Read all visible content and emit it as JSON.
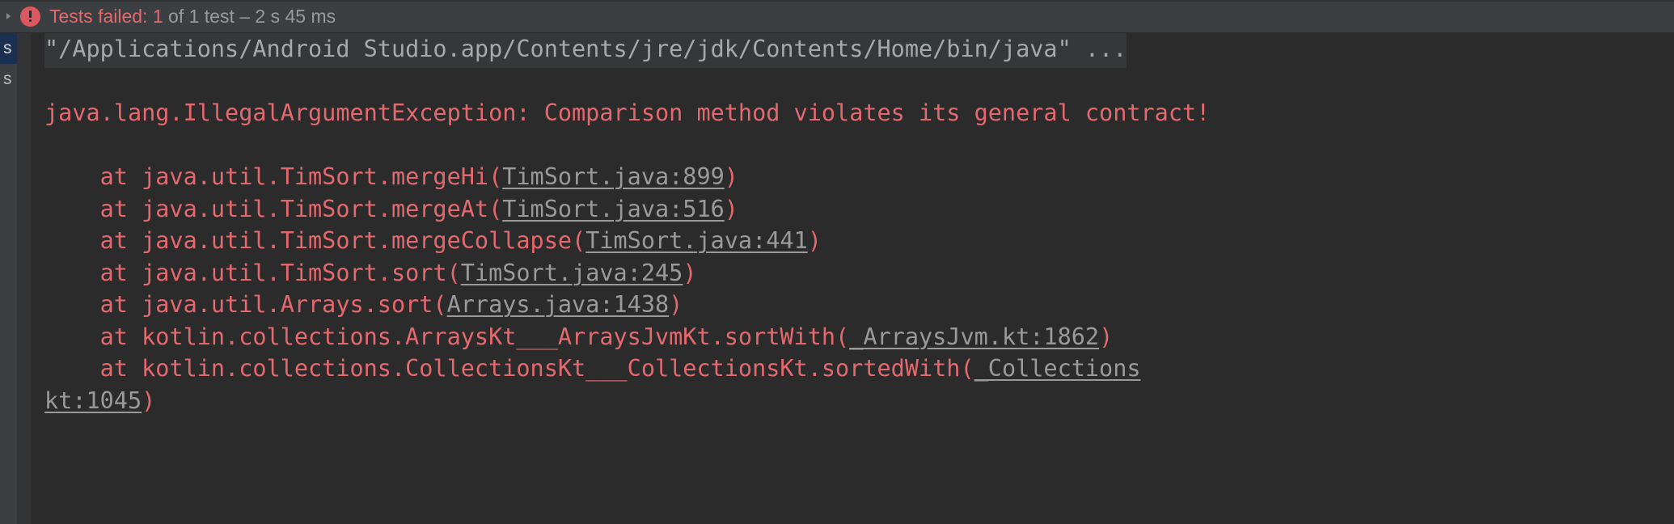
{
  "topbar": {
    "twisty_icon": "collapse-triangle-icon",
    "status_icon": "error-circle-icon",
    "status_failed_label": "Tests failed: ",
    "status_failed_count": "1",
    "status_of_total": " of 1 test ",
    "status_duration": "– 2 s 45 ms"
  },
  "tree": {
    "rows": [
      {
        "label": "s",
        "selected": true
      },
      {
        "label": "s",
        "selected": false
      }
    ]
  },
  "console": {
    "lines": [
      {
        "kind": "cmd",
        "segments": [
          {
            "type": "highlight",
            "text": "\"/Applications/Android Studio.app/Contents/jre/jdk/Contents/Home/bin/java\" ..."
          }
        ]
      },
      {
        "kind": "blank",
        "segments": [
          {
            "type": "plain",
            "text": " "
          }
        ]
      },
      {
        "kind": "error",
        "segments": [
          {
            "type": "plain",
            "text": "java.lang.IllegalArgumentException: Comparison method violates its general contract!"
          }
        ]
      },
      {
        "kind": "blank",
        "segments": [
          {
            "type": "plain",
            "text": " "
          }
        ]
      },
      {
        "kind": "trace",
        "segments": [
          {
            "type": "plain",
            "text": "    at java.util.TimSort.mergeHi("
          },
          {
            "type": "link",
            "text": "TimSort.java:899"
          },
          {
            "type": "plain",
            "text": ")"
          }
        ]
      },
      {
        "kind": "trace",
        "segments": [
          {
            "type": "plain",
            "text": "    at java.util.TimSort.mergeAt("
          },
          {
            "type": "link",
            "text": "TimSort.java:516"
          },
          {
            "type": "plain",
            "text": ")"
          }
        ]
      },
      {
        "kind": "trace",
        "segments": [
          {
            "type": "plain",
            "text": "    at java.util.TimSort.mergeCollapse("
          },
          {
            "type": "link",
            "text": "TimSort.java:441"
          },
          {
            "type": "plain",
            "text": ")"
          }
        ]
      },
      {
        "kind": "trace",
        "segments": [
          {
            "type": "plain",
            "text": "    at java.util.TimSort.sort("
          },
          {
            "type": "link",
            "text": "TimSort.java:245"
          },
          {
            "type": "plain",
            "text": ")"
          }
        ]
      },
      {
        "kind": "trace",
        "segments": [
          {
            "type": "plain",
            "text": "    at java.util.Arrays.sort("
          },
          {
            "type": "link",
            "text": "Arrays.java:1438"
          },
          {
            "type": "plain",
            "text": ")"
          }
        ]
      },
      {
        "kind": "trace",
        "segments": [
          {
            "type": "plain",
            "text": "    at kotlin.collections.ArraysKt___ArraysJvmKt.sortWith("
          },
          {
            "type": "link",
            "text": "_ArraysJvm.kt:1862"
          },
          {
            "type": "plain",
            "text": ")"
          }
        ]
      },
      {
        "kind": "trace",
        "segments": [
          {
            "type": "plain",
            "text": "    at kotlin.collections.CollectionsKt___CollectionsKt.sortedWith("
          },
          {
            "type": "link",
            "text": "_Collections"
          }
        ]
      },
      {
        "kind": "trace",
        "segments": [
          {
            "type": "link",
            "text": "kt:1045"
          },
          {
            "type": "plain",
            "text": ")"
          }
        ]
      }
    ]
  }
}
